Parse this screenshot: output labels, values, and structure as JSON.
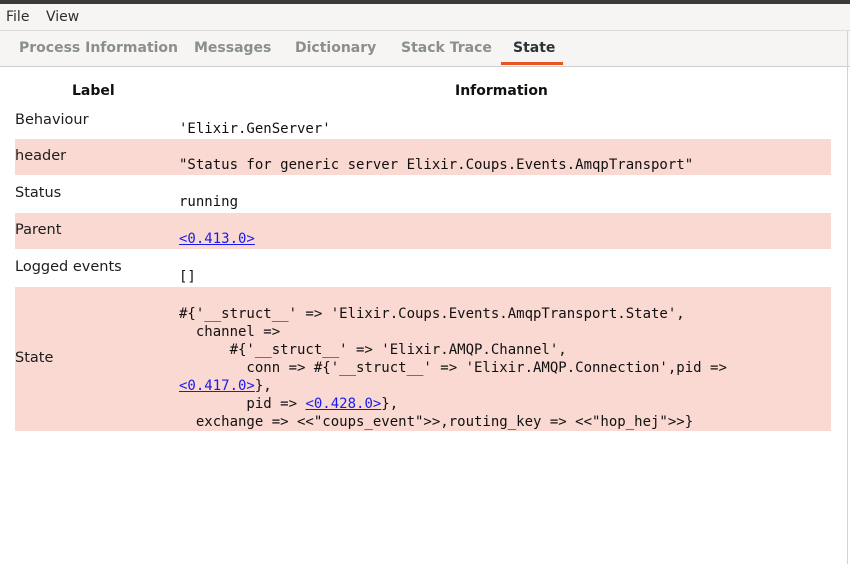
{
  "menu": {
    "file": "File",
    "view": "View"
  },
  "tabs": [
    {
      "label": "Process Information"
    },
    {
      "label": "Messages"
    },
    {
      "label": "Dictionary"
    },
    {
      "label": "Stack Trace"
    },
    {
      "label": "State"
    }
  ],
  "active_tab": "State",
  "colors": {
    "accent": "#e95420",
    "row_highlight": "#f9d9d1",
    "link": "#1a1aee"
  },
  "table": {
    "headers": {
      "label": "Label",
      "information": "Information"
    },
    "rows": [
      {
        "label": "Behaviour",
        "value": "'Elixir.GenServer'"
      },
      {
        "label": "header",
        "value": "\"Status for generic server Elixir.Coups.Events.AmqpTransport\""
      },
      {
        "label": "Status",
        "value": "running"
      },
      {
        "label": "Parent",
        "value": "<0.413.0>"
      },
      {
        "label": "Logged events",
        "value": "[]"
      },
      {
        "label": "State",
        "lines": {
          "l1": "#{'__struct__' => 'Elixir.Coups.Events.AmqpTransport.State',",
          "l2": "  channel =>",
          "l3": "      #{'__struct__' => 'Elixir.AMQP.Channel',",
          "l4": "        conn => #{'__struct__' => 'Elixir.AMQP.Connection',pid =>",
          "l5_link": "<0.417.0>",
          "l5_rest": "},",
          "l6_pre": "        pid => ",
          "l6_link": "<0.428.0>",
          "l6_rest": "},",
          "l7": "  exchange => <<\"coups_event\">>,routing_key => <<\"hop_hej\">>}"
        }
      }
    ]
  }
}
